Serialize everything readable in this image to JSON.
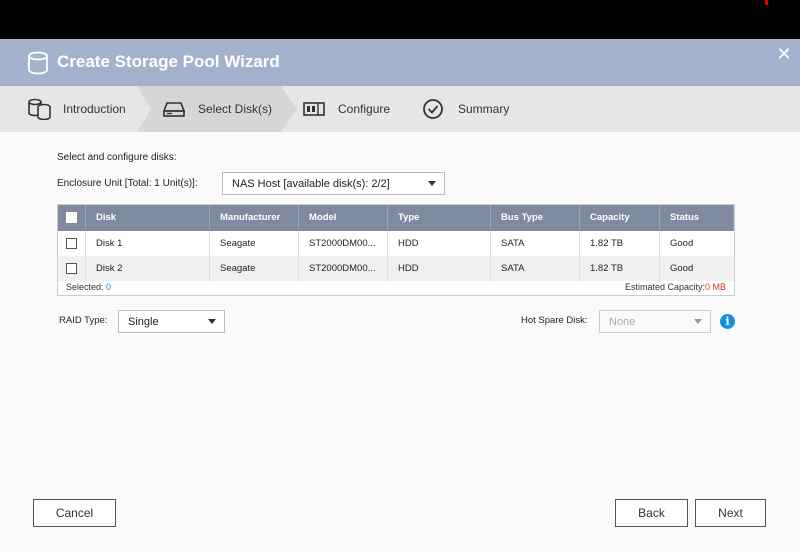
{
  "dialog": {
    "title": "Create Storage Pool Wizard"
  },
  "steps": [
    {
      "label": "Introduction",
      "icon": "disks-icon"
    },
    {
      "label": "Select Disk(s)",
      "icon": "hard-drive-icon"
    },
    {
      "label": "Configure",
      "icon": "configure-icon"
    },
    {
      "label": "Summary",
      "icon": "check-circle-icon"
    }
  ],
  "form": {
    "heading": "Select and configure disks:",
    "enclosure_label": "Enclosure Unit [Total: 1 Unit(s)]:",
    "enclosure_value": "NAS Host [available disk(s): 2/2]",
    "raid_label": "RAID Type:",
    "raid_value": "Single",
    "hot_spare_label": "Hot Spare Disk:",
    "hot_spare_value": "None"
  },
  "table": {
    "columns": [
      "Disk",
      "Manufacturer",
      "Model",
      "Type",
      "Bus Type",
      "Capacity",
      "Status"
    ],
    "rows": [
      {
        "disk": "Disk 1",
        "manufacturer": "Seagate",
        "model": "ST2000DM00...",
        "type": "HDD",
        "bus": "SATA",
        "capacity": "1.82 TB",
        "status": "Good"
      },
      {
        "disk": "Disk 2",
        "manufacturer": "Seagate",
        "model": "ST2000DM00...",
        "type": "HDD",
        "bus": "SATA",
        "capacity": "1.82 TB",
        "status": "Good"
      }
    ],
    "selected_label": "Selected:",
    "selected_count": "0",
    "estimated_label": "Estimated Capacity:",
    "estimated_value": "0 MB"
  },
  "buttons": {
    "cancel": "Cancel",
    "back": "Back",
    "next": "Next"
  },
  "colors": {
    "title_bar": "#a3b1cc",
    "table_header": "#7f8a9f",
    "accent_blue": "#1a8fe0",
    "warning_red": "#d9342b"
  }
}
